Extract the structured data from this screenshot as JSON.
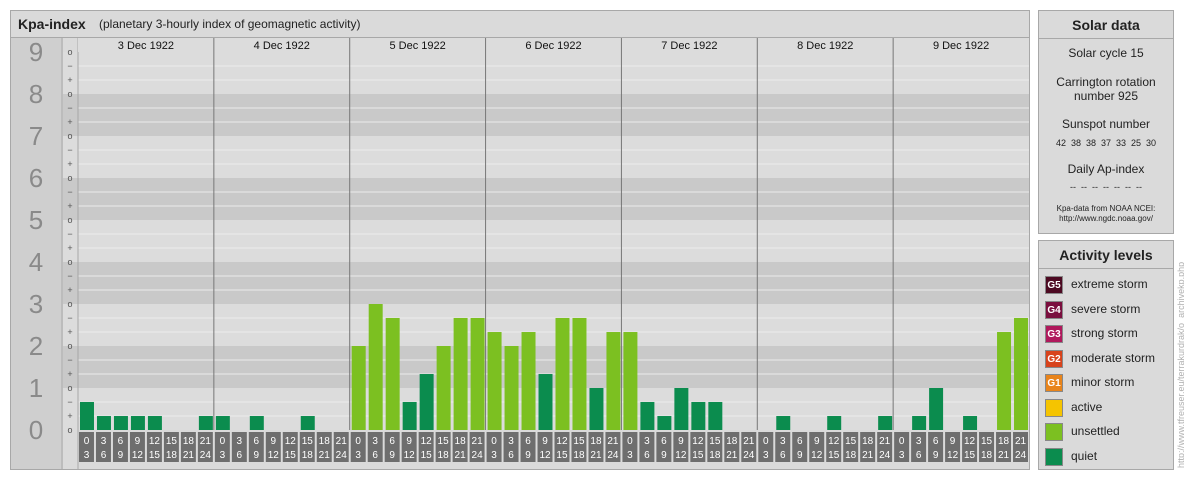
{
  "header": {
    "title": "Kpa-index",
    "subtitle": "(planetary 3-hourly index of geomagnetic activity)"
  },
  "chart_data": {
    "type": "bar",
    "ylim": [
      0,
      9
    ],
    "y_ticks": [
      "0",
      "1",
      "2",
      "3",
      "4",
      "5",
      "6",
      "7",
      "8",
      "9"
    ],
    "y_subticks": [
      "o",
      "+",
      "−"
    ],
    "days": [
      "3 Dec 1922",
      "4 Dec 1922",
      "5 Dec 1922",
      "6 Dec 1922",
      "7 Dec 1922",
      "8 Dec 1922",
      "9 Dec 1922"
    ],
    "hour_starts": [
      "0",
      "3",
      "6",
      "9",
      "12",
      "15",
      "18",
      "21"
    ],
    "hour_ends": [
      "3",
      "6",
      "9",
      "12",
      "15",
      "18",
      "21",
      "24"
    ],
    "values": [
      [
        0.667,
        0.333,
        0.333,
        0.333,
        0.333,
        0,
        0,
        0.333
      ],
      [
        0.333,
        0,
        0.333,
        0,
        0,
        0.333,
        0,
        0
      ],
      [
        2,
        3,
        2.667,
        0.667,
        1.333,
        2,
        2.667,
        2.667
      ],
      [
        2.333,
        2,
        2.333,
        1.333,
        2.667,
        2.667,
        1,
        2.333
      ],
      [
        2.333,
        0.667,
        0.333,
        1,
        0.667,
        0.667,
        0,
        0
      ],
      [
        0,
        0.333,
        0,
        0,
        0.333,
        0,
        0,
        0.333
      ],
      [
        0,
        0.333,
        1,
        0,
        0.333,
        0,
        2.333,
        2.667
      ]
    ],
    "colors": {
      "quiet": "#0b8c4e",
      "unsettled": "#7cc021",
      "active": "#f5c400",
      "minor": "#e8841b",
      "moderate": "#d8431c",
      "strong": "#b0185c",
      "severe": "#7a0e3e",
      "extreme": "#4d0a22"
    }
  },
  "solar": {
    "title": "Solar data",
    "cycle": "Solar cycle 15",
    "carrington_line1": "Carrington rotation",
    "carrington_line2": "number 925",
    "sunspot_title": "Sunspot number",
    "sunspots": "42  38  38  37  33  25  30",
    "ap_title": "Daily Ap-index",
    "ap_values": "--  --  --  --  --  --  --",
    "source_line1": "Kpa-data from NOAA NCEI:",
    "source_line2": "http://www.ngdc.noaa.gov/"
  },
  "levels": {
    "title": "Activity levels",
    "items": [
      {
        "badge": "G5",
        "label": "extreme storm",
        "color": "#4d0a22"
      },
      {
        "badge": "G4",
        "label": "severe storm",
        "color": "#7a0e3e"
      },
      {
        "badge": "G3",
        "label": "strong storm",
        "color": "#b0185c"
      },
      {
        "badge": "G2",
        "label": "moderate storm",
        "color": "#d8431c"
      },
      {
        "badge": "G1",
        "label": "minor storm",
        "color": "#e8841b"
      },
      {
        "badge": "",
        "label": "active",
        "color": "#f5c400"
      },
      {
        "badge": "",
        "label": "unsettled",
        "color": "#7cc021"
      },
      {
        "badge": "",
        "label": "quiet",
        "color": "#0b8c4e"
      }
    ]
  },
  "watermark": "http://www.tfreuser.eu/terrakurdrak/o_archivekp.php"
}
